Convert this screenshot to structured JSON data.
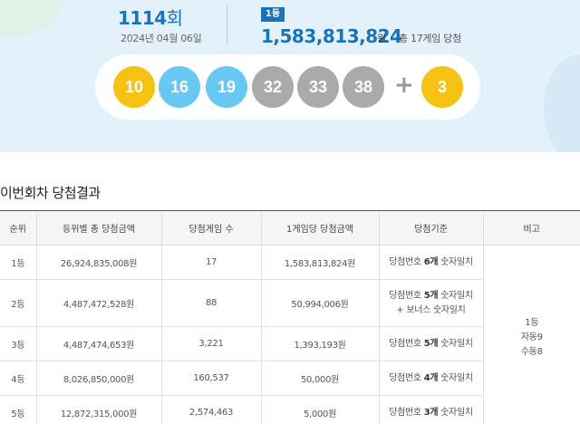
{
  "draw": {
    "round_number": "1114",
    "round_unit": "회",
    "date": "2024년 04월 06일",
    "rank_badge": "1등",
    "prize_amount": "1,583,813,824",
    "prize_unit": "원",
    "winners_text": "총 17게임 당첨"
  },
  "balls": [
    {
      "number": "10",
      "color": "#f5c211"
    },
    {
      "number": "16",
      "color": "#69c8f2"
    },
    {
      "number": "19",
      "color": "#69c8f2"
    },
    {
      "number": "32",
      "color": "#aaaaaa"
    },
    {
      "number": "33",
      "color": "#aaaaaa"
    },
    {
      "number": "38",
      "color": "#aaaaaa"
    }
  ],
  "plus_sign": "+",
  "bonus_ball": {
    "number": "3",
    "color": "#f5c211"
  },
  "results": {
    "title": "이번회차 당첨결과",
    "headers": [
      "순위",
      "등위별 총 당첨금액",
      "당첨게임 수",
      "1게임당 당첨금액",
      "당첨기준",
      "비고"
    ],
    "rows": [
      {
        "rank": "1등",
        "total": "26,924,835,008원",
        "games": "17",
        "per_game": "1,583,813,824원",
        "crit_pre": "당첨번호 ",
        "crit_count": "6개",
        "crit_post": " 숫자일치",
        "bonus_line": ""
      },
      {
        "rank": "2등",
        "total": "4,487,472,528원",
        "games": "88",
        "per_game": "50,994,006원",
        "crit_pre": "당첨번호 ",
        "crit_count": "5개",
        "crit_post": " 숫자일치",
        "bonus_line": "+ 보너스 숫자일치"
      },
      {
        "rank": "3등",
        "total": "4,487,474,653원",
        "games": "3,221",
        "per_game": "1,393,193원",
        "crit_pre": "당첨번호 ",
        "crit_count": "5개",
        "crit_post": " 숫자일치",
        "bonus_line": ""
      },
      {
        "rank": "4등",
        "total": "8,026,850,000원",
        "games": "160,537",
        "per_game": "50,000원",
        "crit_pre": "당첨번호 ",
        "crit_count": "4개",
        "crit_post": " 숫자일치",
        "bonus_line": ""
      },
      {
        "rank": "5등",
        "total": "12,872,315,000원",
        "games": "2,574,463",
        "per_game": "5,000원",
        "crit_pre": "당첨번호 ",
        "crit_count": "3개",
        "crit_post": " 숫자일치",
        "bonus_line": ""
      }
    ],
    "remark": {
      "line1": "1등",
      "line2": "자동9",
      "line3": "수동8"
    }
  }
}
